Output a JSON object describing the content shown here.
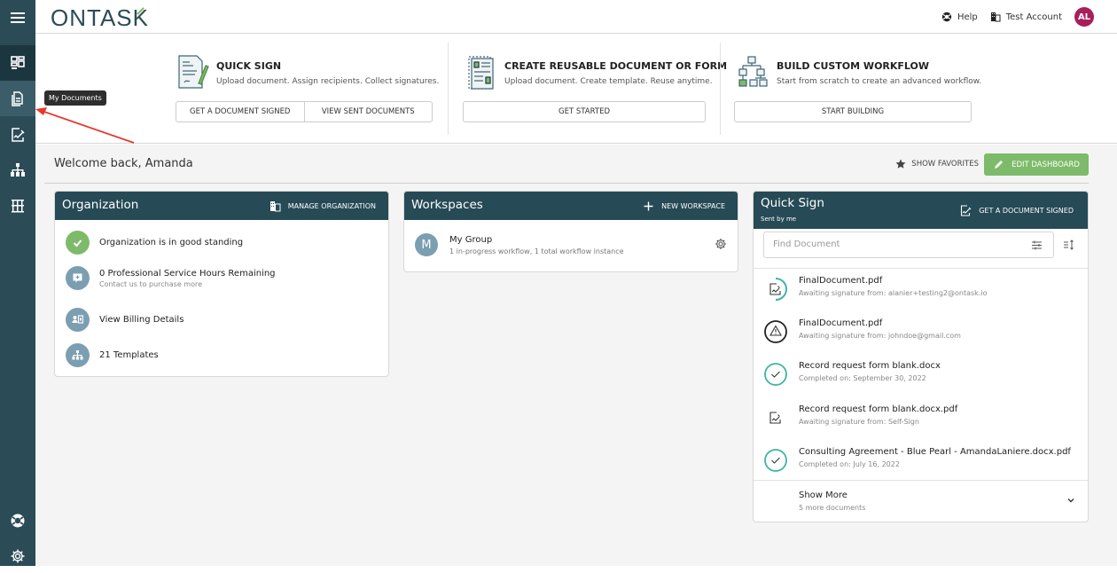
{
  "app": {
    "logo": "ONTAS",
    "logo_k": "K"
  },
  "sidebar": {
    "items": [
      {
        "name": "menu",
        "tooltip": ""
      },
      {
        "name": "dashboard",
        "tooltip": ""
      },
      {
        "name": "my-documents",
        "tooltip": "My Documents"
      },
      {
        "name": "quick-sign",
        "tooltip": ""
      },
      {
        "name": "workflows",
        "tooltip": ""
      },
      {
        "name": "templates",
        "tooltip": ""
      },
      {
        "name": "help",
        "tooltip": ""
      },
      {
        "name": "settings",
        "tooltip": ""
      }
    ],
    "tooltip_text": "My Documents"
  },
  "topbar": {
    "help_label": "Help",
    "account_label": "Test Account",
    "avatar_initials": "AL",
    "avatar_color": "#a81f5c"
  },
  "actions": {
    "quick_sign": {
      "title": "QUICK SIGN",
      "desc": "Upload document. Assign recipients. Collect signatures.",
      "buttons": [
        "GET A DOCUMENT SIGNED",
        "VIEW SENT DOCUMENTS"
      ]
    },
    "reusable": {
      "title": "CREATE REUSABLE DOCUMENT OR FORM",
      "desc": "Upload document. Create template. Reuse anytime.",
      "buttons": [
        "GET STARTED"
      ]
    },
    "workflow": {
      "title": "BUILD CUSTOM WORKFLOW",
      "desc": "Start from scratch to create an advanced workflow.",
      "buttons": [
        "START BUILDING"
      ]
    }
  },
  "main": {
    "welcome": "Welcome back, Amanda",
    "show_favorites": "SHOW FAVORITES",
    "edit_dashboard": "EDIT DASHBOARD",
    "accent_green": "#7dbb6a",
    "header_color": "#264a56"
  },
  "organization": {
    "title": "Organization",
    "action": "MANAGE ORGANIZATION",
    "items": [
      {
        "text": "Organization is in good standing",
        "sub": "",
        "icon": "check-icon",
        "color": "#7dbb6a"
      },
      {
        "text": "0 Professional Service Hours Remaining",
        "sub": "Contact us to purchase more",
        "icon": "support-chat-icon",
        "color": "#7b9fb1"
      },
      {
        "text": "View Billing Details",
        "sub": "",
        "icon": "billing-icon",
        "color": "#7b9fb1"
      },
      {
        "text": "21 Templates",
        "sub": "",
        "icon": "templates-icon",
        "color": "#7b9fb1"
      }
    ]
  },
  "workspaces": {
    "title": "Workspaces",
    "action": "NEW WORKSPACE",
    "items": [
      {
        "initial": "M",
        "name": "My Group",
        "sub": "1 in-progress workflow, 1 total workflow instance"
      }
    ]
  },
  "quicksign": {
    "title": "Quick Sign",
    "subtitle": "Sent by me",
    "action": "GET A DOCUMENT SIGNED",
    "search_placeholder": "Find Document",
    "documents": [
      {
        "name": "FinalDocument.pdf",
        "status": "Awaiting signature from: alanier+testing2@ontask.io",
        "icon": "in-progress-sign-icon"
      },
      {
        "name": "FinalDocument.pdf",
        "status": "Awaiting signature from: johndoe@gmail.com",
        "icon": "warning-icon"
      },
      {
        "name": "Record request form blank.docx",
        "status": "Completed on: September 30, 2022",
        "icon": "completed-icon"
      },
      {
        "name": "Record request form blank.docx.pdf",
        "status": "Awaiting signature from: Self-Sign",
        "icon": "sign-document-icon"
      },
      {
        "name": "Consulting Agreement - Blue Pearl - AmandaLaniere.docx.pdf",
        "status": "Completed on: July 16, 2022",
        "icon": "completed-icon"
      }
    ],
    "show_more": "Show More",
    "show_more_sub": "5 more documents",
    "teal": "#3fb5a3"
  }
}
